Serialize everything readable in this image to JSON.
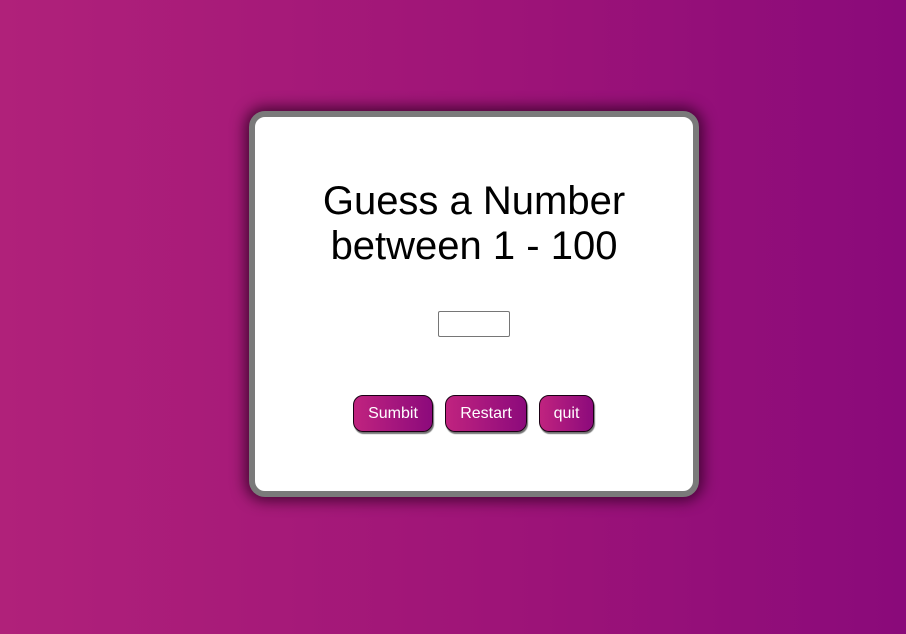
{
  "game": {
    "title_line1": "Guess a Number",
    "title_line2": "between 1 - 100",
    "guess_input": {
      "value": "",
      "placeholder": ""
    },
    "buttons": {
      "submit": "Sumbit",
      "restart": "Restart",
      "quit": "quit"
    }
  },
  "colors": {
    "background_start": "#b0217a",
    "background_end": "#8a0a7a",
    "card_border": "#7a7a7a",
    "button_gradient_start": "#c0237f",
    "button_gradient_end": "#8c0a7c"
  }
}
